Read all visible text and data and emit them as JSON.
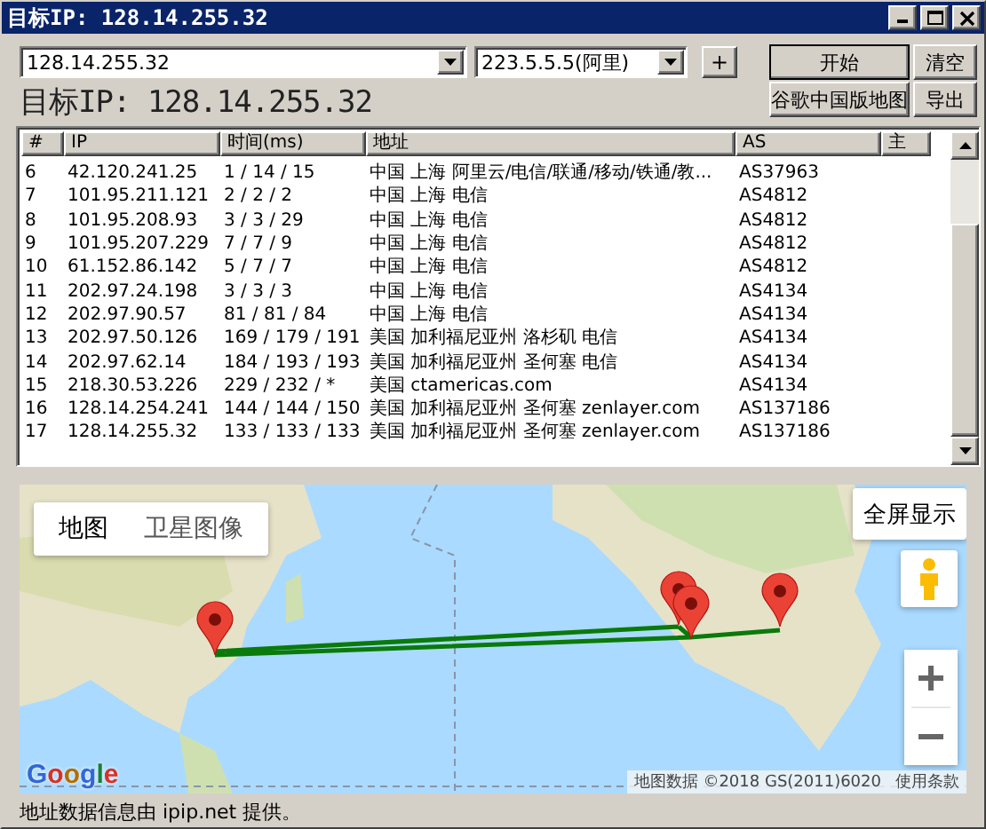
{
  "window": {
    "title": "目标IP: 128.14.255.32"
  },
  "toolbar": {
    "ip_input": "128.14.255.32",
    "dns_select": "223.5.5.5(阿里)",
    "add_button": "+",
    "buttons": [
      {
        "label": "开始",
        "default": true
      },
      {
        "label": "清空",
        "default": false
      },
      {
        "label": "谷歌中国版地图",
        "default": false
      },
      {
        "label": "导出",
        "default": false
      }
    ]
  },
  "target_label": "目标IP: 128.14.255.32",
  "table": {
    "columns": [
      "#",
      "IP",
      "时间(ms)",
      "地址",
      "AS",
      "主"
    ],
    "rows": [
      [
        "6",
        "42.120.241.25",
        "1 / 14 / 15",
        "中国 上海 阿里云/电信/联通/移动/铁通/教...",
        "AS37963"
      ],
      [
        "7",
        "101.95.211.121",
        "2 / 2 / 2",
        "中国 上海 电信",
        "AS4812"
      ],
      [
        "8",
        "101.95.208.93",
        "3 / 3 / 29",
        "中国 上海 电信",
        "AS4812"
      ],
      [
        "9",
        "101.95.207.229",
        "7 / 7 / 9",
        "中国 上海 电信",
        "AS4812"
      ],
      [
        "10",
        "61.152.86.142",
        "5 / 7 / 7",
        "中国 上海 电信",
        "AS4812"
      ],
      [
        "11",
        "202.97.24.198",
        "3 / 3 / 3",
        "中国 上海 电信",
        "AS4134"
      ],
      [
        "12",
        "202.97.90.57",
        "81 / 81 / 84",
        "中国 上海 电信",
        "AS4134"
      ],
      [
        "13",
        "202.97.50.126",
        "169 / 179 / 191",
        "美国 加利福尼亚州 洛杉矶 电信",
        "AS4134"
      ],
      [
        "14",
        "202.97.62.14",
        "184 / 193 / 193",
        "美国 加利福尼亚州 圣何塞 电信",
        "AS4134"
      ],
      [
        "15",
        "218.30.53.226",
        "229 / 232 / *",
        "美国 ctamericas.com",
        "AS4134"
      ],
      [
        "16",
        "128.14.254.241",
        "144 / 144 / 150",
        "美国 加利福尼亚州 圣何塞 zenlayer.com",
        "AS137186"
      ],
      [
        "17",
        "128.14.255.32",
        "133 / 133 / 133",
        "美国 加利福尼亚州 圣何塞 zenlayer.com",
        "AS137186"
      ]
    ]
  },
  "map": {
    "map_types": [
      {
        "label": "地图",
        "selected": true
      },
      {
        "label": "卫星图像",
        "selected": false
      }
    ],
    "fullscreen_button": "全屏显示",
    "logo": "Google",
    "attribution": "地图数据 ©2018 GS(2011)6020",
    "terms_link": "使用条款"
  },
  "footer": "地址数据信息由 ipip.net 提供。"
}
